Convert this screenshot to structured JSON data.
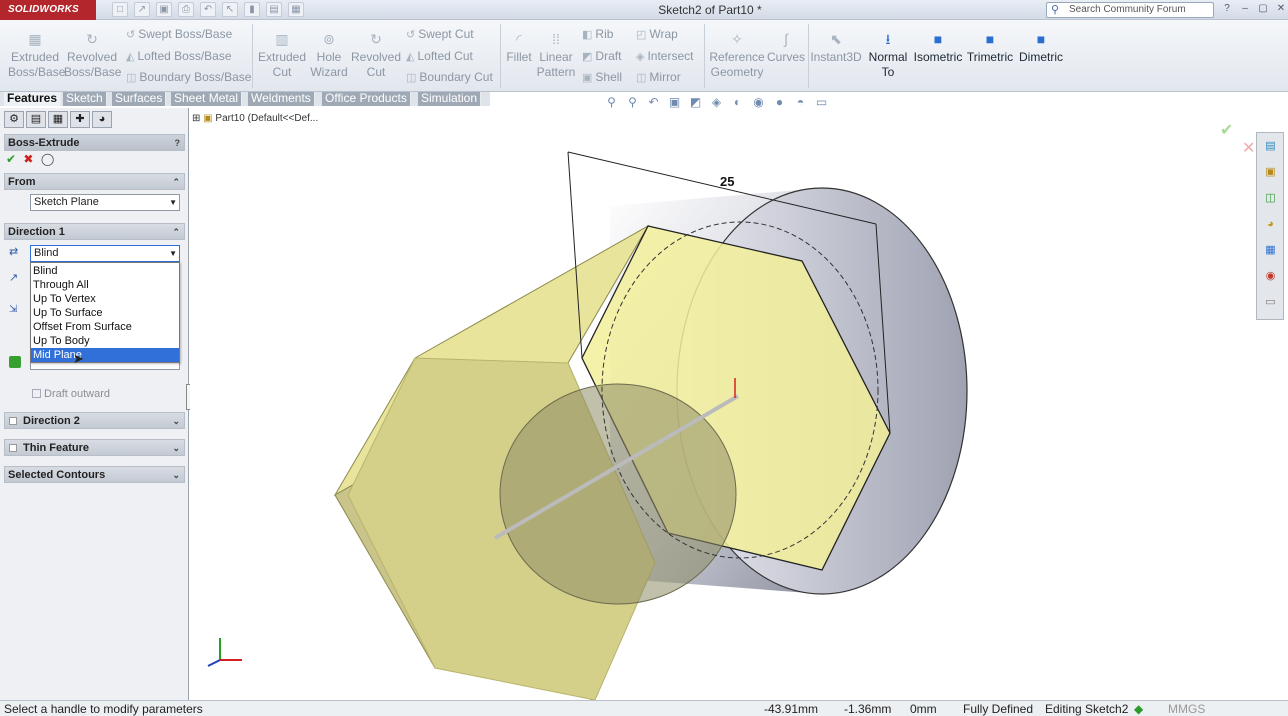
{
  "app": {
    "logo": "SOLIDWORKS",
    "window_title": "Sketch2 of Part10 *"
  },
  "search": {
    "placeholder": "Search Community Forum"
  },
  "ribbon": {
    "extruded_boss": "Extruded\nBoss/Base",
    "revolved_boss": "Revolved\nBoss/Base",
    "swept_boss": "Swept Boss/Base",
    "lofted_boss": "Lofted Boss/Base",
    "boundary_boss": "Boundary Boss/Base",
    "extruded_cut": "Extruded\nCut",
    "hole_wizard": "Hole\nWizard",
    "revolved_cut": "Revolved\nCut",
    "swept_cut": "Swept Cut",
    "lofted_cut": "Lofted Cut",
    "boundary_cut": "Boundary Cut",
    "fillet": "Fillet",
    "linear_pattern": "Linear\nPattern",
    "rib": "Rib",
    "draft": "Draft",
    "shell": "Shell",
    "wrap": "Wrap",
    "intersect": "Intersect",
    "mirror": "Mirror",
    "reference_geometry": "Reference\nGeometry",
    "curves": "Curves",
    "instant3d": "Instant3D",
    "normal_to": "Normal\nTo",
    "isometric": "Isometric",
    "trimetric": "Trimetric",
    "dimetric": "Dimetric"
  },
  "tabs": [
    "Features",
    "Sketch",
    "Surfaces",
    "Sheet Metal",
    "Weldments",
    "Office Products",
    "Simulation"
  ],
  "tree": {
    "item": "Part10  (Default<<Def..."
  },
  "panel": {
    "title": "Boss-Extrude",
    "from_header": "From",
    "from_value": "Sketch Plane",
    "direction1_header": "Direction 1",
    "direction1_value": "Blind",
    "end_options": [
      "Blind",
      "Through All",
      "Up To Vertex",
      "Up To Surface",
      "Offset From Surface",
      "Up To Body",
      "Mid Plane"
    ],
    "selected_option": "Mid Plane",
    "draft_outward": "Draft outward",
    "direction2_header": "Direction 2",
    "thin_feature_header": "Thin Feature",
    "selected_contours_header": "Selected Contours"
  },
  "viewport": {
    "dimension": "25"
  },
  "status": {
    "message": "Select a handle to modify parameters",
    "x": "-43.91mm",
    "y": "-1.36mm",
    "z": "0mm",
    "state": "Fully Defined",
    "editing": "Editing Sketch2",
    "units": "MMGS"
  },
  "colors": {
    "accent": "#3070d8",
    "face": "#f2ef9a",
    "logo_red": "#b3262b"
  }
}
